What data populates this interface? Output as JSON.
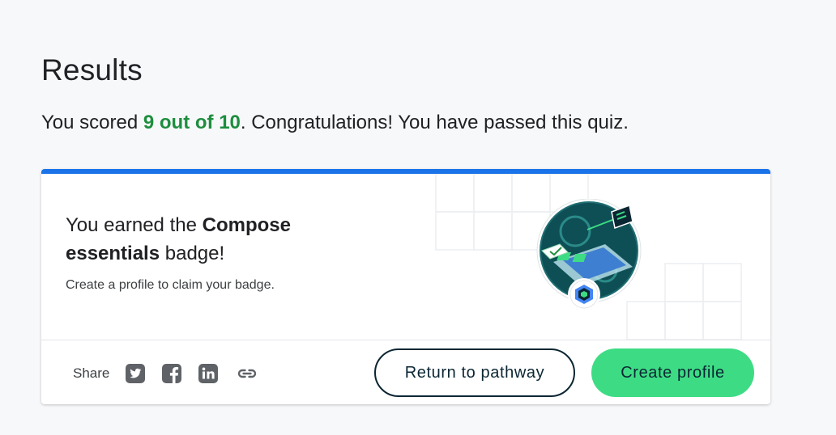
{
  "results": {
    "title": "Results",
    "score_prefix": "You scored ",
    "score": "9 out of 10",
    "score_suffix": ". Congratulations! You have passed this quiz."
  },
  "badge_card": {
    "heading_prefix": "You earned the ",
    "badge_name": "Compose essentials",
    "heading_suffix": " badge!",
    "subtext": "Create a profile to claim your badge.",
    "badge_icon": "jetpack-compose-badge"
  },
  "share": {
    "label": "Share",
    "icons": [
      "twitter-icon",
      "facebook-icon",
      "linkedin-icon",
      "link-icon"
    ]
  },
  "actions": {
    "return_label": "Return to pathway",
    "create_label": "Create profile"
  },
  "colors": {
    "accent_bar": "#1a73e8",
    "score_green": "#1e8e3e",
    "primary_button": "#3ddc84",
    "button_text": "#0b2633"
  }
}
